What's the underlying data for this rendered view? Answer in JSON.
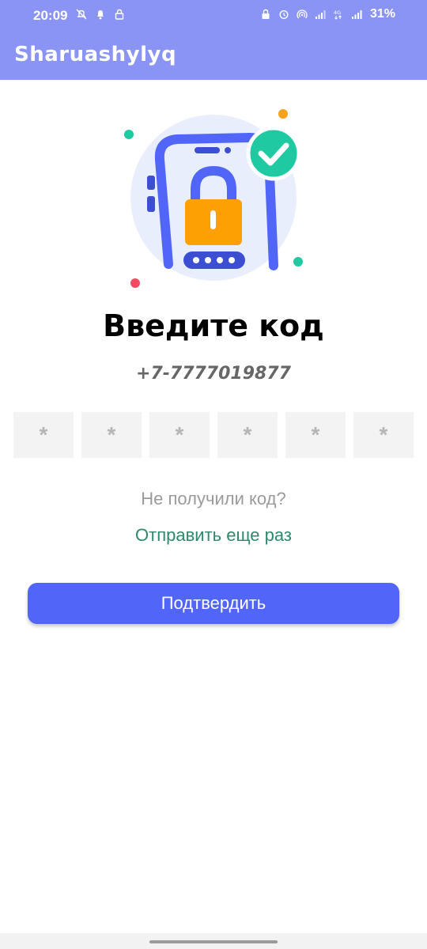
{
  "status_bar": {
    "time": "20:09",
    "battery": "31%",
    "left_icons": [
      "notifications-off-icon",
      "bell-icon",
      "lock-icon"
    ],
    "right_icons": [
      "lock-icon",
      "alarm-icon",
      "hotspot-icon",
      "signal-icon",
      "network-4g-icon",
      "signal-icon"
    ]
  },
  "app_bar": {
    "title": "Sharuashylyq",
    "background_color": "#8a94f5"
  },
  "screen": {
    "illustration": "phone-lock-check-icon",
    "heading": "Введите код",
    "phone_number": "+7-7777019877",
    "code_inputs": [
      {
        "placeholder": "*"
      },
      {
        "placeholder": "*"
      },
      {
        "placeholder": "*"
      },
      {
        "placeholder": "*"
      },
      {
        "placeholder": "*"
      },
      {
        "placeholder": "*"
      }
    ],
    "no_code_text": "Не получили код?",
    "resend_link": "Отправить еще раз",
    "confirm_button": "Подтвердить",
    "accent_color": "#5166f9",
    "link_color": "#2c8a6a"
  }
}
